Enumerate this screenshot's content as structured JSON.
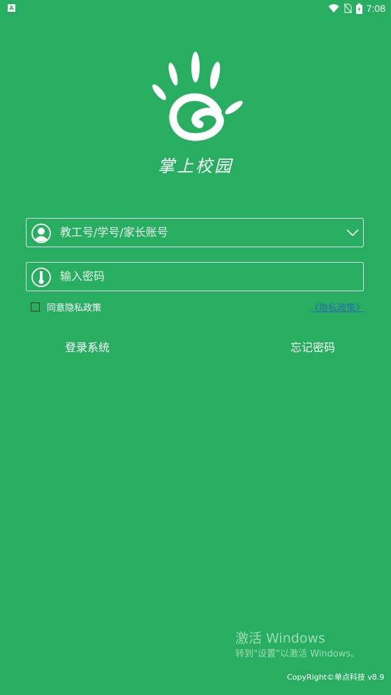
{
  "status_bar": {
    "app_icon_letter": "A",
    "time": "7:08",
    "icons": [
      "wifi-icon",
      "no-sim-icon",
      "battery-charging-icon"
    ]
  },
  "logo": {
    "icon": "hand-logo-icon",
    "title": "掌上校园"
  },
  "login_form": {
    "account_placeholder": "教工号/学号/家长账号",
    "account_icon": "user-icon",
    "account_dropdown_icon": "chevron-down-icon",
    "password_placeholder": "输入密码",
    "password_icon": "lock-icon",
    "agree_label": "同意隐私政策",
    "agree_checked": false,
    "privacy_link": "《隐私政策》"
  },
  "actions": {
    "login_label": "登录系统",
    "forgot_label": "忘记密码"
  },
  "watermark": {
    "title": "激活 Windows",
    "subtitle": "转到\"设置\"以激活 Windows。"
  },
  "footer": {
    "copyright": "CopyRight©单点科技 v8.9"
  },
  "colors": {
    "background": "#27ae60",
    "text": "#ffffff",
    "link": "#2b6cb0"
  }
}
